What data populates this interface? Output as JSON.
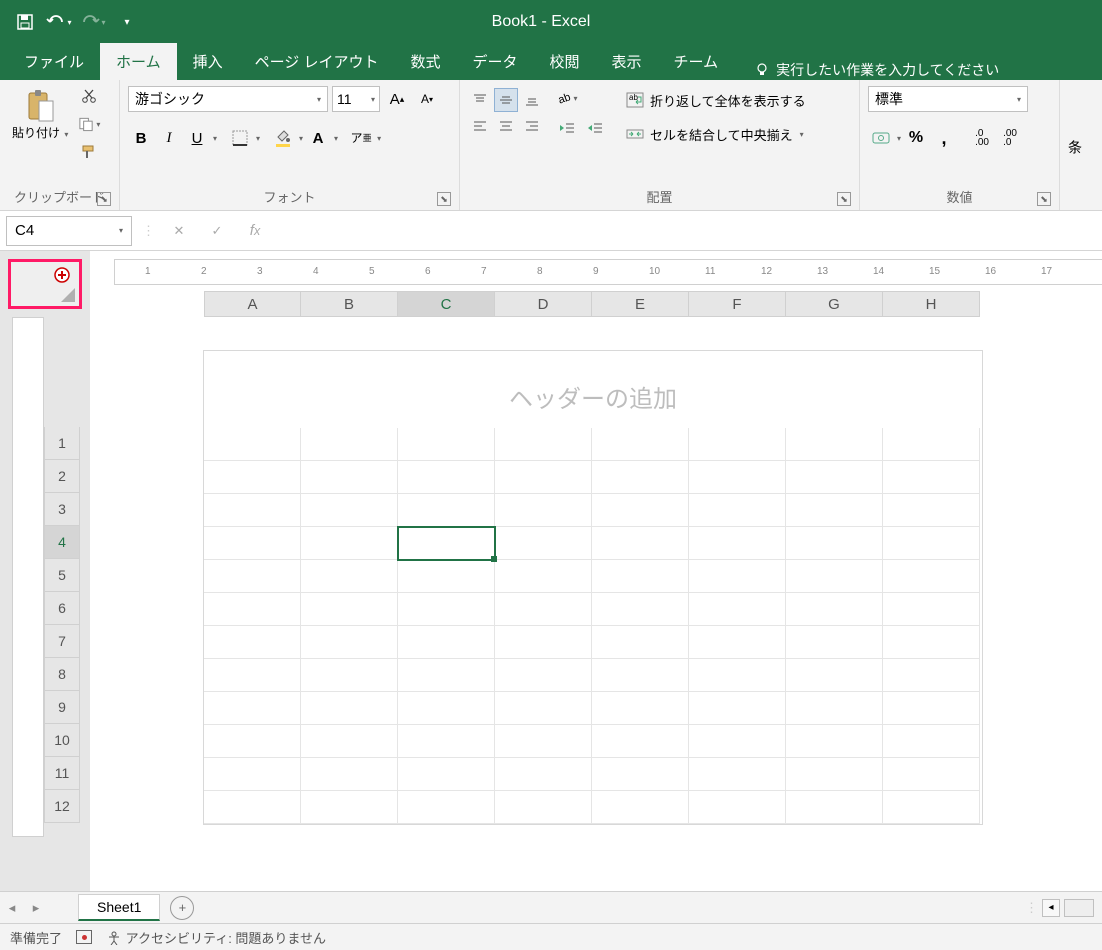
{
  "title": "Book1 - Excel",
  "qat": {
    "save": "保存",
    "undo": "元に戻す",
    "redo": "やり直し"
  },
  "tabs": {
    "file": "ファイル",
    "home": "ホーム",
    "insert": "挿入",
    "pagelayout": "ページ レイアウト",
    "formulas": "数式",
    "data": "データ",
    "review": "校閲",
    "view": "表示",
    "team": "チーム",
    "tellme": "実行したい作業を入力してください"
  },
  "ribbon": {
    "clipboard": {
      "paste": "貼り付け",
      "label": "クリップボード"
    },
    "font": {
      "name": "游ゴシック",
      "size": "11",
      "label": "フォント"
    },
    "alignment": {
      "wrap": "折り返して全体を表示する",
      "merge": "セルを結合して中央揃え",
      "label": "配置"
    },
    "number": {
      "format": "標準",
      "label": "数値"
    },
    "styles_hint": "条"
  },
  "nameBox": "C4",
  "headerPlaceholder": "ヘッダーの追加",
  "columns": [
    "A",
    "B",
    "C",
    "D",
    "E",
    "F",
    "G",
    "H"
  ],
  "rows": [
    "1",
    "2",
    "3",
    "4",
    "5",
    "6",
    "7",
    "8",
    "9",
    "10",
    "11",
    "12"
  ],
  "selected": {
    "col": "C",
    "row": "4"
  },
  "sheetTab": "Sheet1",
  "status": {
    "ready": "準備完了",
    "a11y": "アクセシビリティ: 問題ありません"
  },
  "ruler": [
    "1",
    "2",
    "3",
    "4",
    "5",
    "6",
    "7",
    "8",
    "9",
    "10",
    "11",
    "12",
    "13",
    "14",
    "15",
    "16",
    "17"
  ]
}
